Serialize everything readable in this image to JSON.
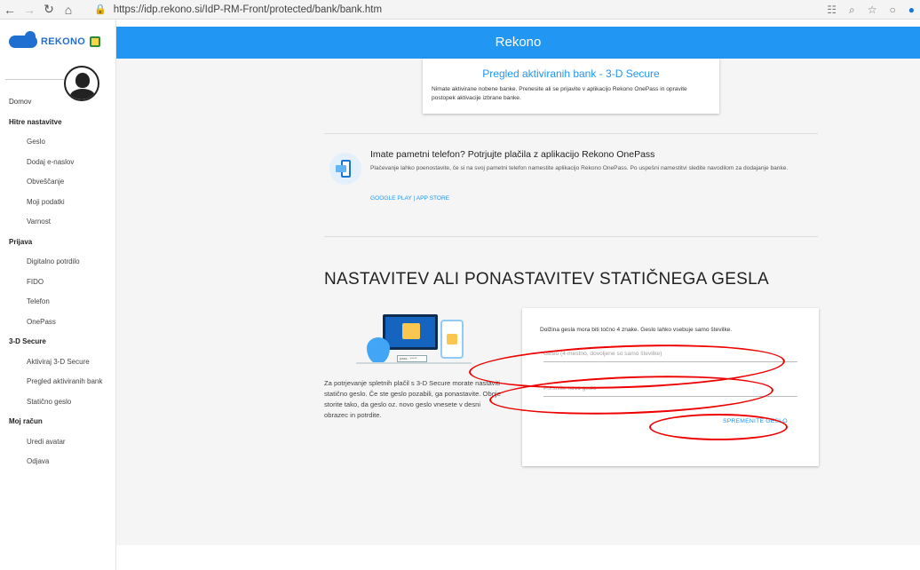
{
  "browser": {
    "back": "←",
    "forward": "→",
    "reload": "↻",
    "home": "⌂",
    "lock": "🔒",
    "url": "https://idp.rekono.si/IdP-RM-Front/protected/bank/bank.htm"
  },
  "sidebar": {
    "logo_text": "REKONO",
    "top_item": "Domov",
    "sections": [
      {
        "title": "Hitre nastavitve",
        "items": [
          "Geslo",
          "Dodaj e-naslov",
          "Obveščanje",
          "Moji podatki",
          "Varnost"
        ]
      },
      {
        "title": "Prijava",
        "items": [
          "Digitalno potrdilo",
          "FIDO",
          "Telefon",
          "OnePass"
        ]
      },
      {
        "title": "3-D Secure",
        "items": [
          "Aktiviraj 3-D Secure",
          "Pregled aktiviranih bank",
          "Statično geslo"
        ]
      },
      {
        "title": "Moj račun",
        "items": [
          "Uredi avatar",
          "Odjava"
        ]
      }
    ]
  },
  "header": {
    "title": "Rekono"
  },
  "bank_card": {
    "title": "Pregled aktiviranih bank - 3-D Secure",
    "text": "Nimate aktivirane nobene banke. Prenesite ali se prijavite v aplikacijo Rekono OnePass in opravite postopek aktivacije izbrane banke."
  },
  "promo": {
    "title": "Imate pametni telefon? Potrjujte plačila z aplikacijo Rekono OnePass",
    "text": "Plačevanje lahko poenostavite, če si na svoj pametni telefon namestite aplikacijo Rekono OnePass. Po uspešni namestitvi sledite navodilom za dodajanje banke.",
    "google_play": "GOOGLE PLAY",
    "separator": "|",
    "app_store": "APP STORE"
  },
  "static_password": {
    "title": "NASTAVITEV ALI PONASTAVITEV STATIČNEGA GESLA",
    "illustration_pass": "pass : *****",
    "explanation": "Za potrjevanje spletnih plačil s 3-D Secure morate nastaviti statično geslo. Če ste geslo pozabili, ga ponastavite. Oboje storite tako, da geslo oz. novo geslo vnesete v desni obrazec in potrdite.",
    "info": "Dolžina gesla mora biti točno 4 znake. Geslo lahko vsebuje samo številke.",
    "field1_placeholder": "Geslo (4-mestno, dovoljene so samo številke)",
    "field2_placeholder": "Ponovite novo geslo",
    "submit": "SPREMENITE GESLO"
  },
  "colors": {
    "accent": "#2196f3",
    "annotation": "#ee0000"
  }
}
